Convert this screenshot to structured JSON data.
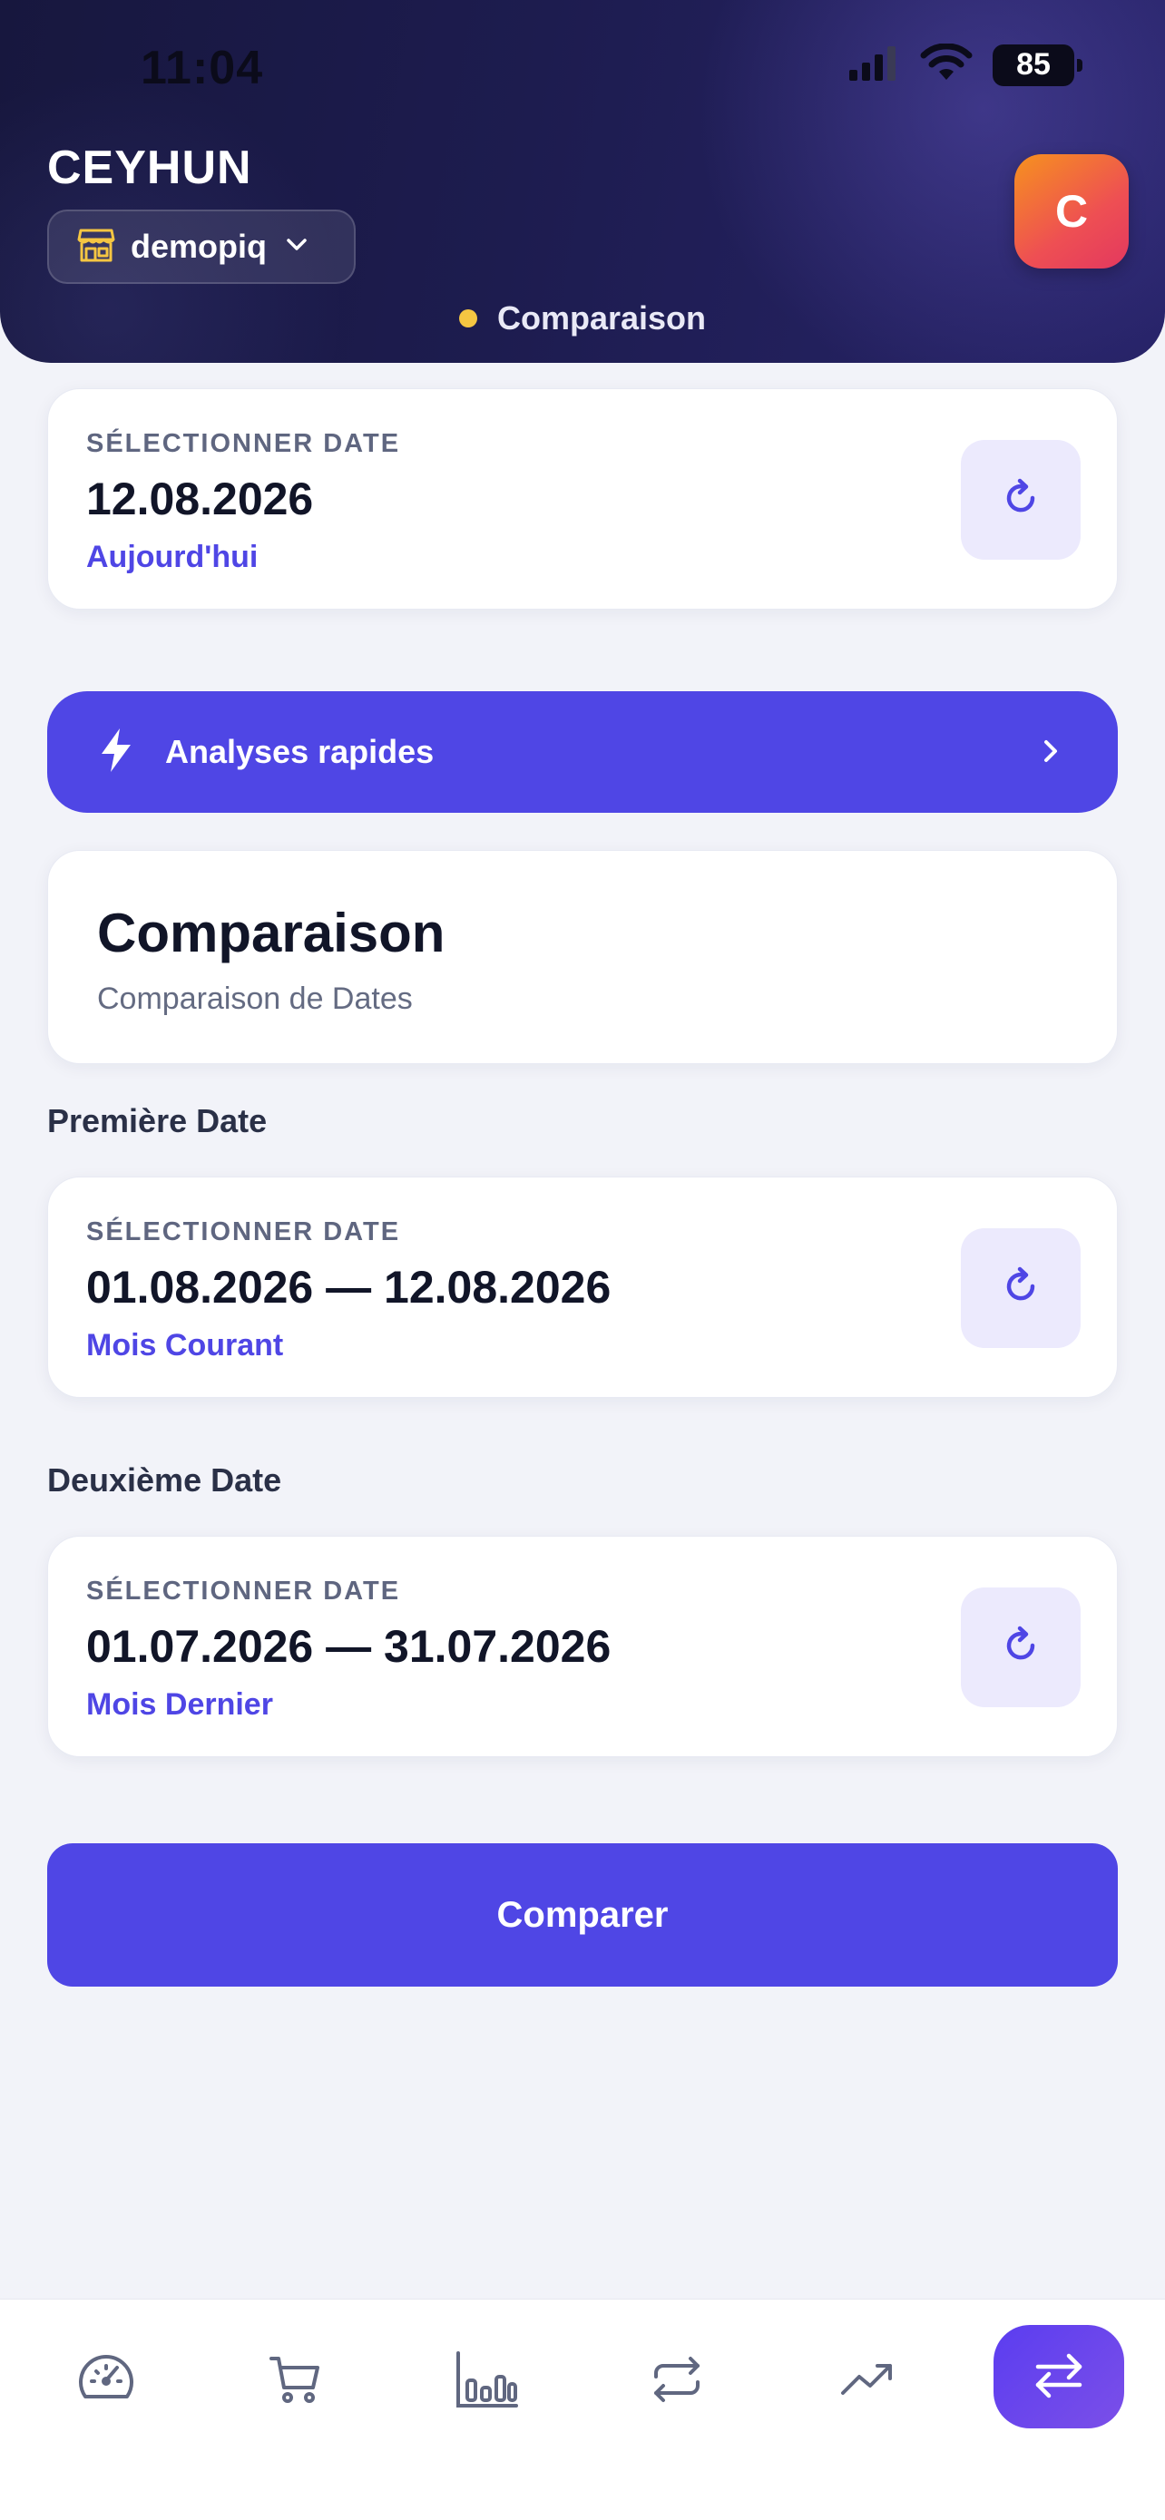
{
  "status_bar": {
    "time": "11:04",
    "battery": "85"
  },
  "header": {
    "user_name": "CEYHUN",
    "store": "demopiq",
    "avatar_letter": "C",
    "current_section": "Comparaison"
  },
  "main_date": {
    "caption": "SÉLECTIONNER DATE",
    "value": "12.08.2026",
    "subtitle": "Aujourd'hui"
  },
  "quick_analyses": {
    "label": "Analyses rapides"
  },
  "comparison": {
    "title": "Comparaison",
    "subtitle": "Comparaison de Dates"
  },
  "first_date": {
    "section_label": "Première Date",
    "caption": "SÉLECTIONNER DATE",
    "value": "01.08.2026 — 12.08.2026",
    "subtitle": "Mois Courant"
  },
  "second_date": {
    "section_label": "Deuxième Date",
    "caption": "SÉLECTIONNER DATE",
    "value": "01.07.2026 — 31.07.2026",
    "subtitle": "Mois Dernier"
  },
  "compare_button": {
    "label": "Comparer"
  },
  "bottom_nav": {
    "items": [
      {
        "icon": "speedometer-icon",
        "active": false
      },
      {
        "icon": "cart-icon",
        "active": false
      },
      {
        "icon": "bar-chart-icon",
        "active": false
      },
      {
        "icon": "repeat-icon",
        "active": false
      },
      {
        "icon": "trending-up-icon",
        "active": false
      },
      {
        "icon": "swap-arrows-icon",
        "active": true
      }
    ]
  },
  "colors": {
    "accent": "#4f46e5",
    "header_bg": "#1d1c4f",
    "avatar_gradient_start": "#f6921e",
    "avatar_gradient_end": "#e3385f",
    "indicator_dot": "#f5c642",
    "page_bg": "#f2f3f9"
  }
}
